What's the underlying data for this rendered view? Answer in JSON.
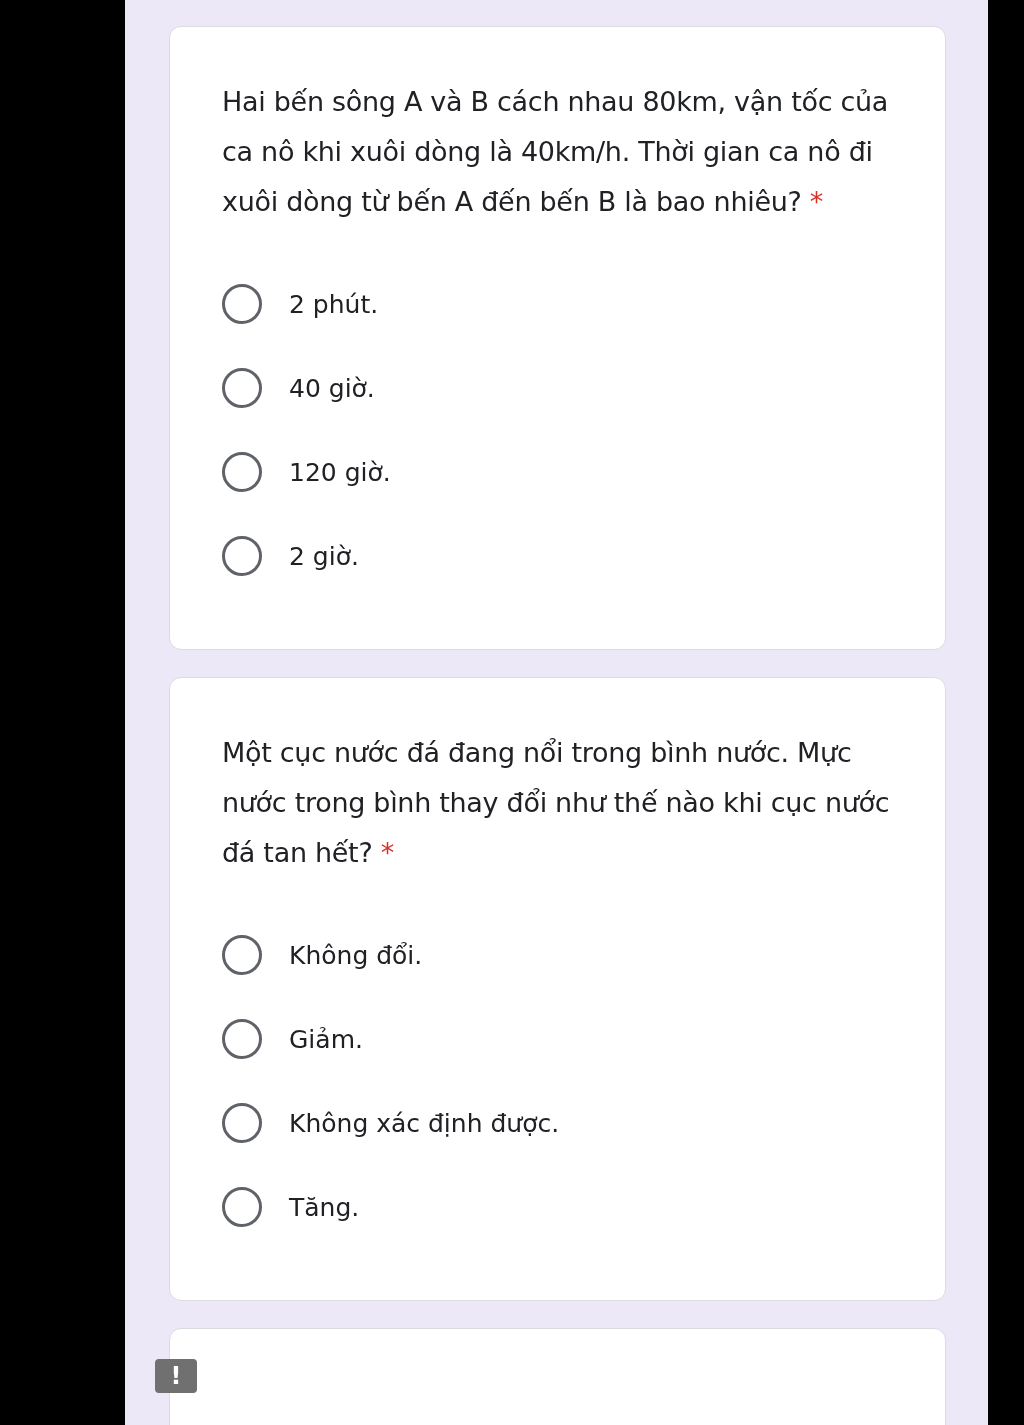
{
  "questions": [
    {
      "text": "Hai bến sông A và B cách nhau 80km, vận tốc của ca nô khi xuôi dòng là 40km/h. Thời gian ca nô đi xuôi dòng từ bến A đến bến B là bao nhiêu?",
      "required_mark": "*",
      "options": [
        {
          "label": "2 phút.",
          "selected": false
        },
        {
          "label": "40 giờ.",
          "selected": false
        },
        {
          "label": "120 giờ.",
          "selected": false
        },
        {
          "label": "2 giờ.",
          "selected": false
        }
      ]
    },
    {
      "text": "Một cục nước đá đang nổi trong bình nước. Mực nước trong bình thay đổi như thế nào khi cục nước đá tan hết?",
      "required_mark": "*",
      "options": [
        {
          "label": "Không đổi.",
          "selected": false
        },
        {
          "label": "Giảm.",
          "selected": false
        },
        {
          "label": "Không xác định được.",
          "selected": false
        },
        {
          "label": "Tăng.",
          "selected": false
        }
      ]
    }
  ],
  "feedback_badge": "!"
}
